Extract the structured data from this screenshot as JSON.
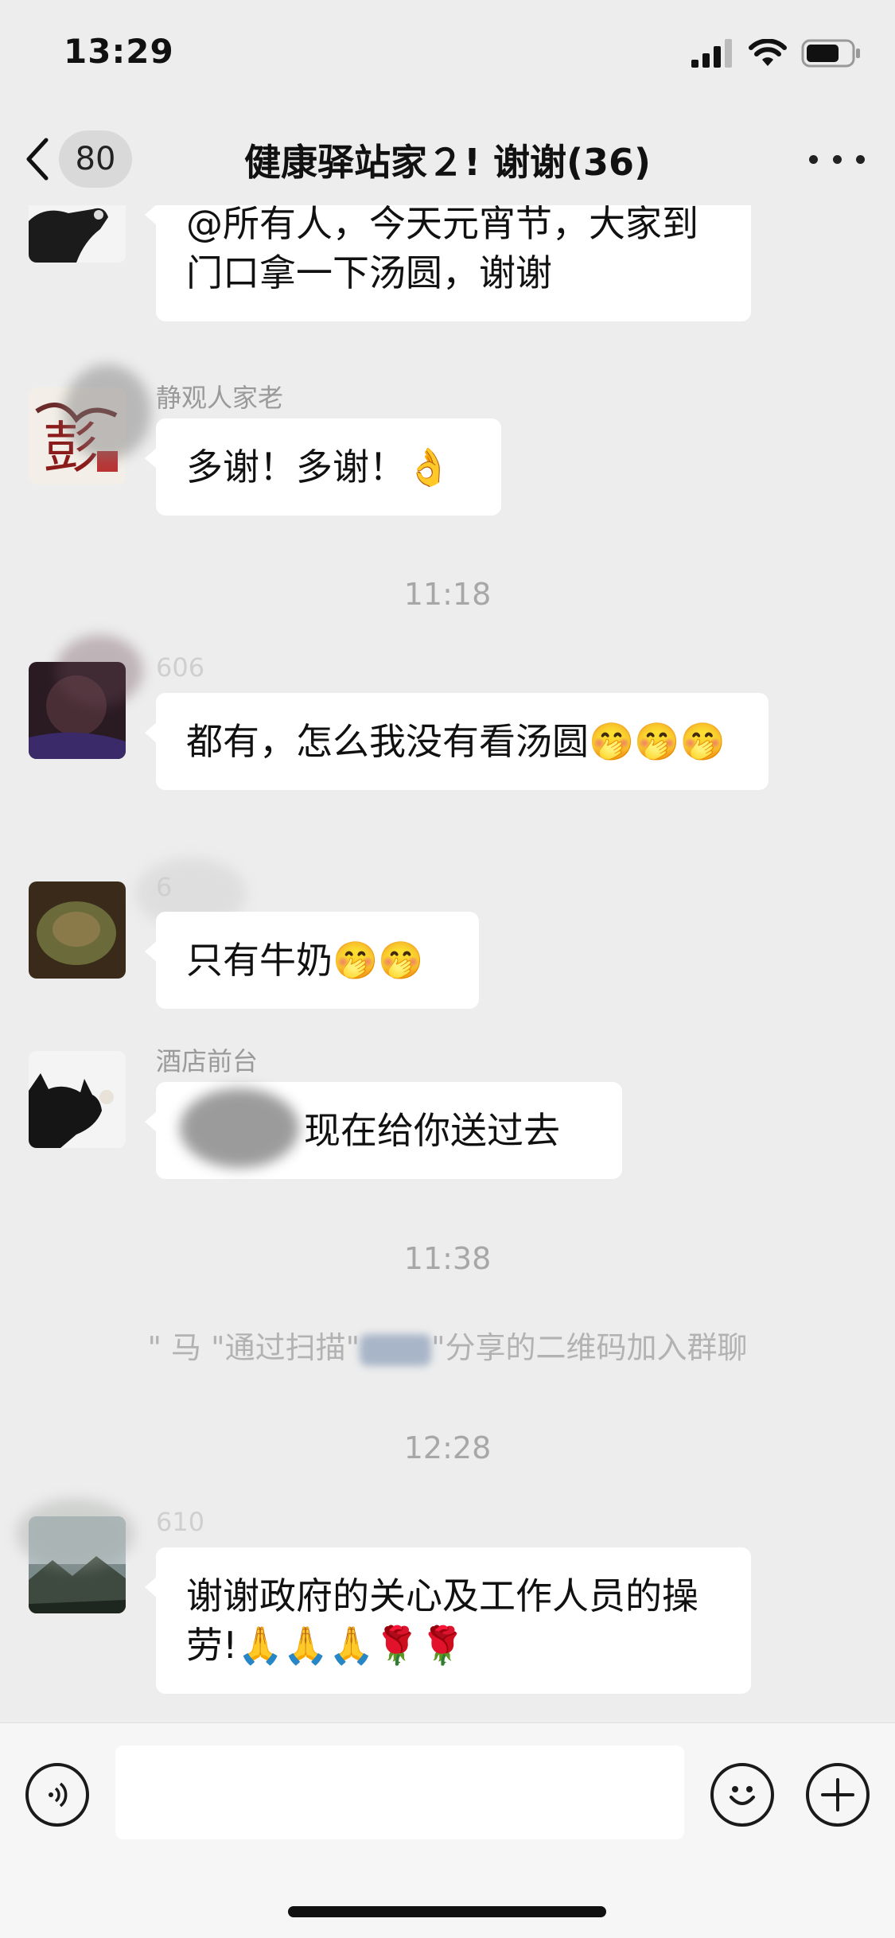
{
  "status_bar": {
    "time": "13:29"
  },
  "nav": {
    "unread_count": "80",
    "title": "健康驿站家２!  谢谢(36)"
  },
  "messages": [
    {
      "sender": "",
      "text": "@所有人，今天元宵节，大家到门口拿一下汤圆，谢谢",
      "avatar": "cat-avatar"
    },
    {
      "sender": "静观人家老",
      "text": "多谢！多谢！👌",
      "avatar": "calligraphy-avatar"
    },
    {
      "sender": "606",
      "text": "都有，怎么我没有看汤圆🤭🤭🤭",
      "avatar": "dark-avatar"
    },
    {
      "sender": "6",
      "text": "只有牛奶🤭🤭",
      "avatar": "olive-avatar"
    },
    {
      "sender": "酒店前台",
      "text": "现在给你送过去",
      "avatar": "cat-avatar"
    },
    {
      "sender": "610",
      "text": "谢谢政府的关心及工作人员的操劳!🙏🙏🙏🌹🌹",
      "avatar": "landscape-avatar"
    }
  ],
  "timestamps": [
    "11:18",
    "11:38",
    "12:28"
  ],
  "system_message": {
    "part1": "\" 马 \"通过扫描\"",
    "part2": "\"分享的二维码加入群聊"
  },
  "colors": {
    "background": "#ededed",
    "bubble": "#ffffff",
    "meta_text": "#a7a7a7"
  }
}
